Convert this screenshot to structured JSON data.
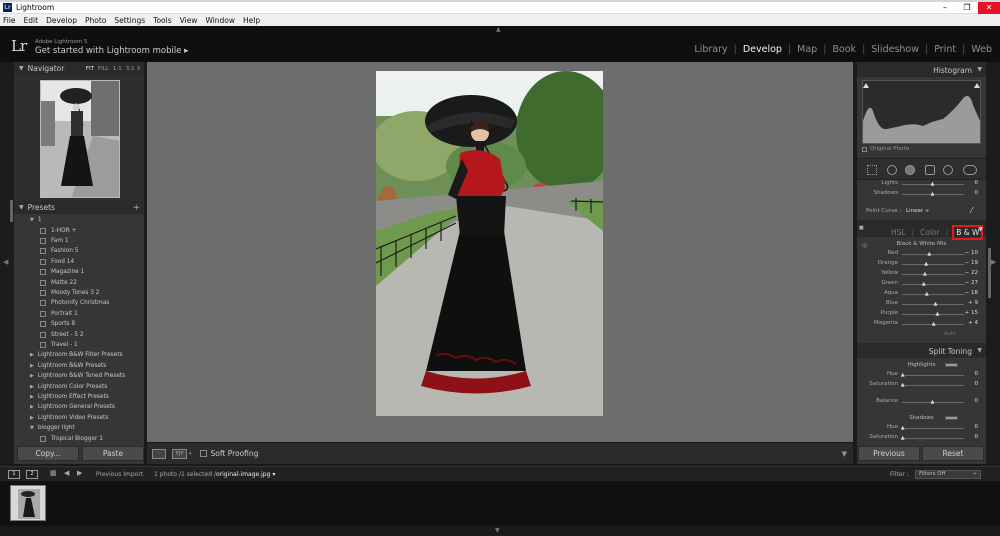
{
  "window": {
    "title": "Lightroom",
    "icon_text": "Lr",
    "controls": [
      "–",
      "❐",
      "✕"
    ]
  },
  "menu": [
    "File",
    "Edit",
    "Develop",
    "Photo",
    "Settings",
    "Tools",
    "View",
    "Window",
    "Help"
  ],
  "identity": {
    "logo": "Lr",
    "version": "Adobe Lightroom 5",
    "mobile_label": "Get started with Lightroom mobile ▸"
  },
  "modules": [
    "Library",
    "Develop",
    "Map",
    "Book",
    "Slideshow",
    "Print",
    "Web"
  ],
  "active_module": "Develop",
  "navigator": {
    "title": "Navigator",
    "zoom": [
      "FIT",
      "FILL",
      "1:1",
      "3:1 ⇕"
    ]
  },
  "presets": {
    "title": "Presets",
    "rows": [
      {
        "type": "folder-open",
        "label": "1"
      },
      {
        "type": "item",
        "label": "1-HOR +"
      },
      {
        "type": "item",
        "label": "Fam 1"
      },
      {
        "type": "item",
        "label": "Fashion 5"
      },
      {
        "type": "item",
        "label": "Food 14"
      },
      {
        "type": "item",
        "label": "Magazine 1"
      },
      {
        "type": "item",
        "label": "Matte 22"
      },
      {
        "type": "item",
        "label": "Moody Tones 3 2"
      },
      {
        "type": "item",
        "label": "Photonify Christmas"
      },
      {
        "type": "item",
        "label": "Portrait 1"
      },
      {
        "type": "item",
        "label": "Sports 8"
      },
      {
        "type": "item",
        "label": "Street - 5 2"
      },
      {
        "type": "item",
        "label": "Travel - 1"
      },
      {
        "type": "folder",
        "label": "Lightroom B&W Filter Presets"
      },
      {
        "type": "folder",
        "label": "Lightroom B&W Presets"
      },
      {
        "type": "folder",
        "label": "Lightroom B&W Toned Presets"
      },
      {
        "type": "folder",
        "label": "Lightroom Color Presets"
      },
      {
        "type": "folder",
        "label": "Lightroom Effect Presets"
      },
      {
        "type": "folder",
        "label": "Lightroom General Presets"
      },
      {
        "type": "folder",
        "label": "Lightroom Video Presets"
      },
      {
        "type": "folder-open",
        "label": "blogger light"
      },
      {
        "type": "item",
        "label": "Tropical Blogger 1"
      }
    ]
  },
  "left_buttons": {
    "copy": "Copy...",
    "paste": "Paste"
  },
  "toolbar": {
    "view_mode": "Y|Y",
    "soft_proofing": "Soft Proofing"
  },
  "histogram": {
    "title": "Histogram",
    "original_photo": "Original Photo"
  },
  "tone": {
    "rows": [
      {
        "label": "Lights",
        "value": "0"
      },
      {
        "label": "Shadows",
        "value": "0"
      }
    ],
    "point_curve_label": "Point Curve :",
    "point_curve_value": "Linear ÷"
  },
  "hsl": {
    "tabs": [
      "HSL",
      "Color",
      "B & W"
    ],
    "active": "B & W"
  },
  "bw_mix": {
    "title": "Black & White Mix",
    "auto": "Auto",
    "channels": [
      {
        "label": "Red",
        "value": "− 10",
        "pos": 0.45
      },
      {
        "label": "Orange",
        "value": "− 19",
        "pos": 0.4
      },
      {
        "label": "Yellow",
        "value": "− 22",
        "pos": 0.38
      },
      {
        "label": "Green",
        "value": "− 27",
        "pos": 0.36
      },
      {
        "label": "Aqua",
        "value": "− 18",
        "pos": 0.41
      },
      {
        "label": "Blue",
        "value": "+ 9",
        "pos": 0.55
      },
      {
        "label": "Purple",
        "value": "+ 15",
        "pos": 0.58
      },
      {
        "label": "Magenta",
        "value": "+ 4",
        "pos": 0.52
      }
    ]
  },
  "split_toning": {
    "title": "Split Toning",
    "highlights": "Highlights",
    "shadows": "Shadows",
    "rows_top": [
      {
        "label": "Hue",
        "value": "0"
      },
      {
        "label": "Saturation",
        "value": "0"
      }
    ],
    "balance": {
      "label": "Balance",
      "value": "0"
    },
    "rows_bottom": [
      {
        "label": "Hue",
        "value": "0"
      },
      {
        "label": "Saturation",
        "value": "0"
      }
    ]
  },
  "right_buttons": {
    "previous": "Previous",
    "reset": "Reset"
  },
  "filmbar": {
    "page1": "1",
    "page2": "2",
    "previous_import": "Previous Import",
    "count": "1 photo /1 selected /",
    "filename": "original-image.jpg ▾",
    "filter_label": "Filter :",
    "filter_value": "Filters Off"
  },
  "colors": {
    "bw_highlight": "#e01b1b",
    "panel": "#363636",
    "center_bg": "#6d6d6d"
  }
}
